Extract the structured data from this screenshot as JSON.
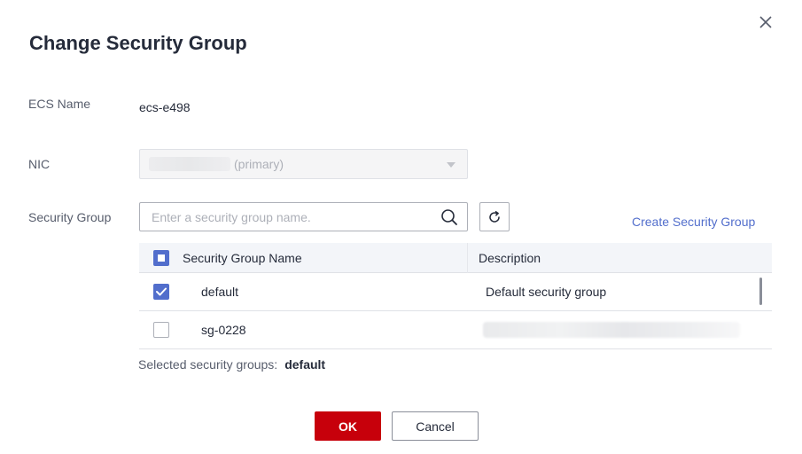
{
  "dialog": {
    "title": "Change Security Group",
    "close_icon": "close-icon"
  },
  "form": {
    "ecs_name_label": "ECS Name",
    "ecs_name_value": "ecs-e498",
    "nic_label": "NIC",
    "nic_selected_suffix": "(primary)",
    "security_group_label": "Security Group"
  },
  "search": {
    "placeholder": "Enter a security group name.",
    "value": "",
    "icon": "search-icon",
    "refresh_icon": "refresh-icon"
  },
  "create_link": "Create Security Group",
  "table": {
    "columns": [
      "Security Group Name",
      "Description"
    ],
    "header_checkbox": "indeterminate",
    "rows": [
      {
        "name": "default",
        "description": "Default security group",
        "checked": true
      },
      {
        "name": "sg-0228",
        "description": "",
        "checked": false
      }
    ]
  },
  "selected": {
    "label": "Selected security groups:",
    "value": "default"
  },
  "footer": {
    "ok_label": "OK",
    "cancel_label": "Cancel"
  },
  "colors": {
    "primary_red": "#c7000b",
    "link_blue": "#526ecc",
    "checkbox_blue": "#526ecc"
  }
}
